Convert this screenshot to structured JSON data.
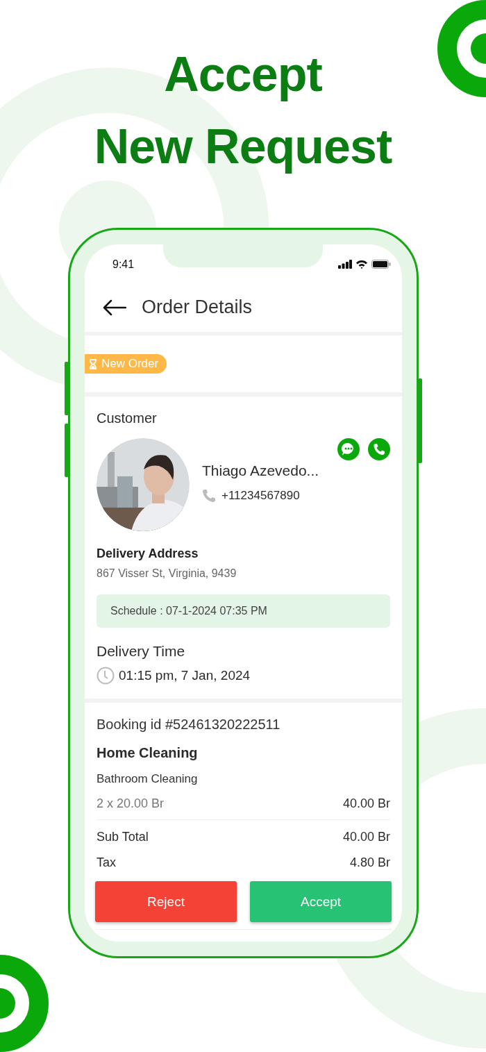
{
  "headline": [
    "Accept",
    "New Request"
  ],
  "status_bar": {
    "time": "9:41"
  },
  "header": {
    "title": "Order Details"
  },
  "badge": {
    "label": "New Order"
  },
  "customer": {
    "heading": "Customer",
    "name": "Thiago Azevedo...",
    "phone": "+11234567890"
  },
  "delivery_address": {
    "label": "Delivery Address",
    "value": "867 Visser St, Virginia, 9439"
  },
  "schedule": "Schedule : 07-1-2024 07:35 PM",
  "delivery_time": {
    "label": "Delivery Time",
    "value": "01:15 pm, 7 Jan, 2024"
  },
  "booking": {
    "id": "Booking id #52461320222511",
    "service": "Home Cleaning",
    "items": [
      {
        "name": "Bathroom Cleaning",
        "quantity": "2 x 20.00 Br",
        "amount": "40.00 Br"
      }
    ],
    "summary": [
      {
        "label": "Sub Total",
        "value": "40.00 Br"
      },
      {
        "label": "Tax",
        "value": "4.80 Br"
      }
    ]
  },
  "actions": [
    {
      "label": "Reject",
      "kind": "reject"
    },
    {
      "label": "Accept",
      "kind": "accept"
    }
  ]
}
